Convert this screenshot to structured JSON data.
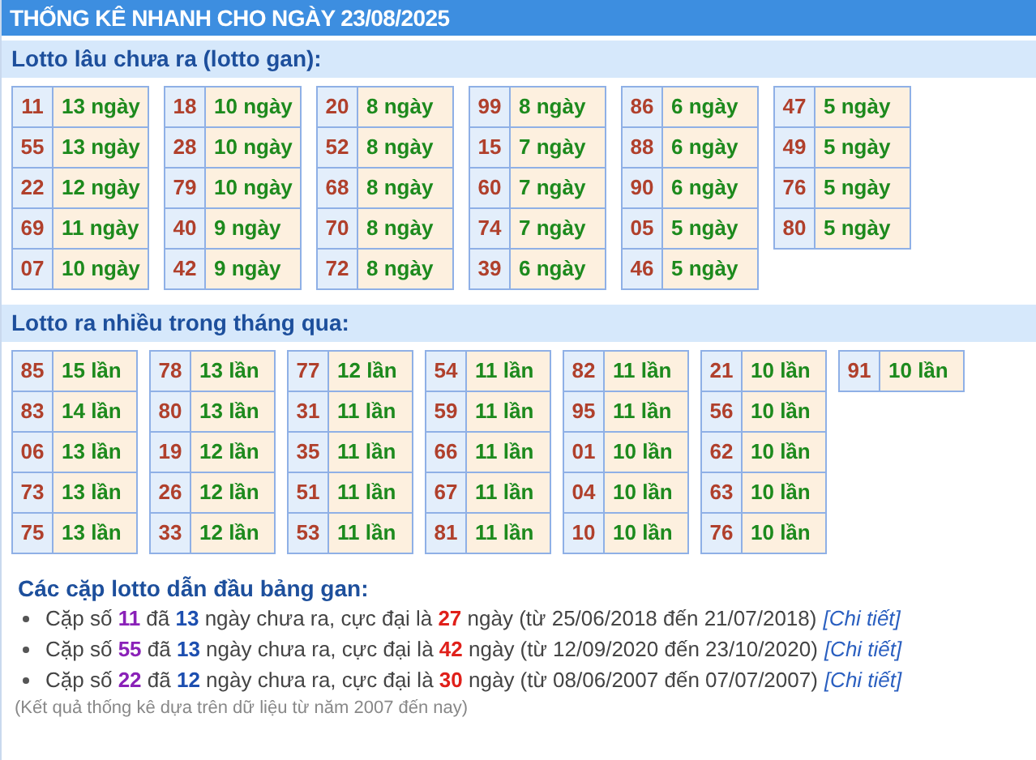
{
  "title": "THỐNG KÊ NHANH CHO NGÀY 23/08/2025",
  "sections": [
    {
      "heading": "Lotto lâu chưa ra (lotto gan):",
      "groups": [
        [
          {
            "number": "11",
            "count": "13 ngày"
          },
          {
            "number": "55",
            "count": "13 ngày"
          },
          {
            "number": "22",
            "count": "12 ngày"
          },
          {
            "number": "69",
            "count": "11 ngày"
          },
          {
            "number": "07",
            "count": "10 ngày"
          }
        ],
        [
          {
            "number": "18",
            "count": "10 ngày"
          },
          {
            "number": "28",
            "count": "10 ngày"
          },
          {
            "number": "79",
            "count": "10 ngày"
          },
          {
            "number": "40",
            "count": "9 ngày"
          },
          {
            "number": "42",
            "count": "9 ngày"
          }
        ],
        [
          {
            "number": "20",
            "count": "8 ngày"
          },
          {
            "number": "52",
            "count": "8 ngày"
          },
          {
            "number": "68",
            "count": "8 ngày"
          },
          {
            "number": "70",
            "count": "8 ngày"
          },
          {
            "number": "72",
            "count": "8 ngày"
          }
        ],
        [
          {
            "number": "99",
            "count": "8 ngày"
          },
          {
            "number": "15",
            "count": "7 ngày"
          },
          {
            "number": "60",
            "count": "7 ngày"
          },
          {
            "number": "74",
            "count": "7 ngày"
          },
          {
            "number": "39",
            "count": "6 ngày"
          }
        ],
        [
          {
            "number": "86",
            "count": "6 ngày"
          },
          {
            "number": "88",
            "count": "6 ngày"
          },
          {
            "number": "90",
            "count": "6 ngày"
          },
          {
            "number": "05",
            "count": "5 ngày"
          },
          {
            "number": "46",
            "count": "5 ngày"
          }
        ],
        [
          {
            "number": "47",
            "count": "5 ngày"
          },
          {
            "number": "49",
            "count": "5 ngày"
          },
          {
            "number": "76",
            "count": "5 ngày"
          },
          {
            "number": "80",
            "count": "5 ngày"
          }
        ]
      ]
    },
    {
      "heading": "Lotto ra nhiều trong tháng qua:",
      "groups": [
        [
          {
            "number": "85",
            "count": "15 lần"
          },
          {
            "number": "83",
            "count": "14 lần"
          },
          {
            "number": "06",
            "count": "13 lần"
          },
          {
            "number": "73",
            "count": "13 lần"
          },
          {
            "number": "75",
            "count": "13 lần"
          }
        ],
        [
          {
            "number": "78",
            "count": "13 lần"
          },
          {
            "number": "80",
            "count": "13 lần"
          },
          {
            "number": "19",
            "count": "12 lần"
          },
          {
            "number": "26",
            "count": "12 lần"
          },
          {
            "number": "33",
            "count": "12 lần"
          }
        ],
        [
          {
            "number": "77",
            "count": "12 lần"
          },
          {
            "number": "31",
            "count": "11 lần"
          },
          {
            "number": "35",
            "count": "11 lần"
          },
          {
            "number": "51",
            "count": "11 lần"
          },
          {
            "number": "53",
            "count": "11 lần"
          }
        ],
        [
          {
            "number": "54",
            "count": "11 lần"
          },
          {
            "number": "59",
            "count": "11 lần"
          },
          {
            "number": "66",
            "count": "11 lần"
          },
          {
            "number": "67",
            "count": "11 lần"
          },
          {
            "number": "81",
            "count": "11 lần"
          }
        ],
        [
          {
            "number": "82",
            "count": "11 lần"
          },
          {
            "number": "95",
            "count": "11 lần"
          },
          {
            "number": "01",
            "count": "10 lần"
          },
          {
            "number": "04",
            "count": "10 lần"
          },
          {
            "number": "10",
            "count": "10 lần"
          }
        ],
        [
          {
            "number": "21",
            "count": "10 lần"
          },
          {
            "number": "56",
            "count": "10 lần"
          },
          {
            "number": "62",
            "count": "10 lần"
          },
          {
            "number": "63",
            "count": "10 lần"
          },
          {
            "number": "76",
            "count": "10 lần"
          }
        ],
        [
          {
            "number": "91",
            "count": "10 lần"
          }
        ]
      ]
    }
  ],
  "pairs": {
    "heading": "Các cặp lotto dẫn đầu bảng gan:",
    "items": [
      {
        "text": "Cặp số **11** đã **13** ngày chưa ra, cực đại là **27** ngày (từ 25/06/2018 đến 21/07/2018)",
        "link": "[Chi tiết]"
      },
      {
        "text": "Cặp số **55** đã **13** ngày chưa ra, cực đại là **42** ngày (từ 12/09/2020 đến 23/10/2020)",
        "link": "[Chi tiết]"
      },
      {
        "text": "Cặp số **22** đã **12** ngày chưa ra, cực đại là **30** ngày (từ 08/06/2007 đến 07/07/2007)",
        "link": "[Chi tiết]"
      }
    ]
  },
  "footnote": "(Kết quả thống kê dựa trên dữ liệu từ năm 2007 đến nay)"
}
